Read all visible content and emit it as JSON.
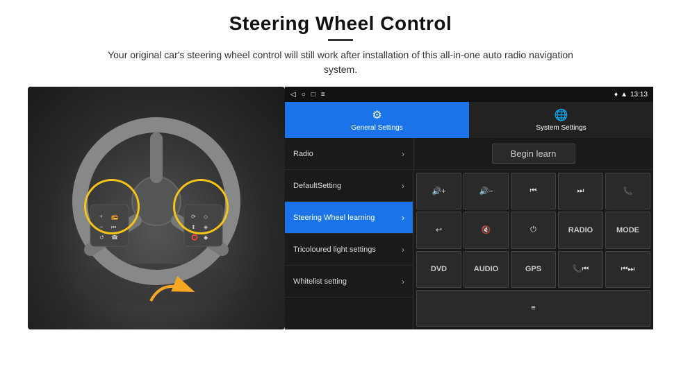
{
  "header": {
    "title": "Steering Wheel Control",
    "subtitle": "Your original car's steering wheel control will still work after installation of this all-in-one auto radio navigation system."
  },
  "status_bar": {
    "back_icon": "◁",
    "home_icon": "○",
    "square_icon": "□",
    "menu_icon": "≡",
    "location_icon": "♦",
    "wifi_icon": "▲",
    "time": "13:13"
  },
  "tabs": [
    {
      "label": "General Settings",
      "icon": "⚙",
      "active": true
    },
    {
      "label": "System Settings",
      "icon": "🌐",
      "active": false
    }
  ],
  "settings_items": [
    {
      "label": "Radio",
      "active": false
    },
    {
      "label": "DefaultSetting",
      "active": false
    },
    {
      "label": "Steering Wheel learning",
      "active": true
    },
    {
      "label": "Tricoloured light settings",
      "active": false
    },
    {
      "label": "Whitelist setting",
      "active": false
    }
  ],
  "begin_learn_label": "Begin learn",
  "control_buttons": {
    "row1": [
      "🔊+",
      "🔊−",
      "⏮",
      "⏭",
      "📞"
    ],
    "row2": [
      "↩",
      "🔇",
      "⏻",
      "RADIO",
      "MODE"
    ],
    "row3": [
      "DVD",
      "AUDIO",
      "GPS",
      "📞⏮",
      "⏮⏭"
    ]
  }
}
